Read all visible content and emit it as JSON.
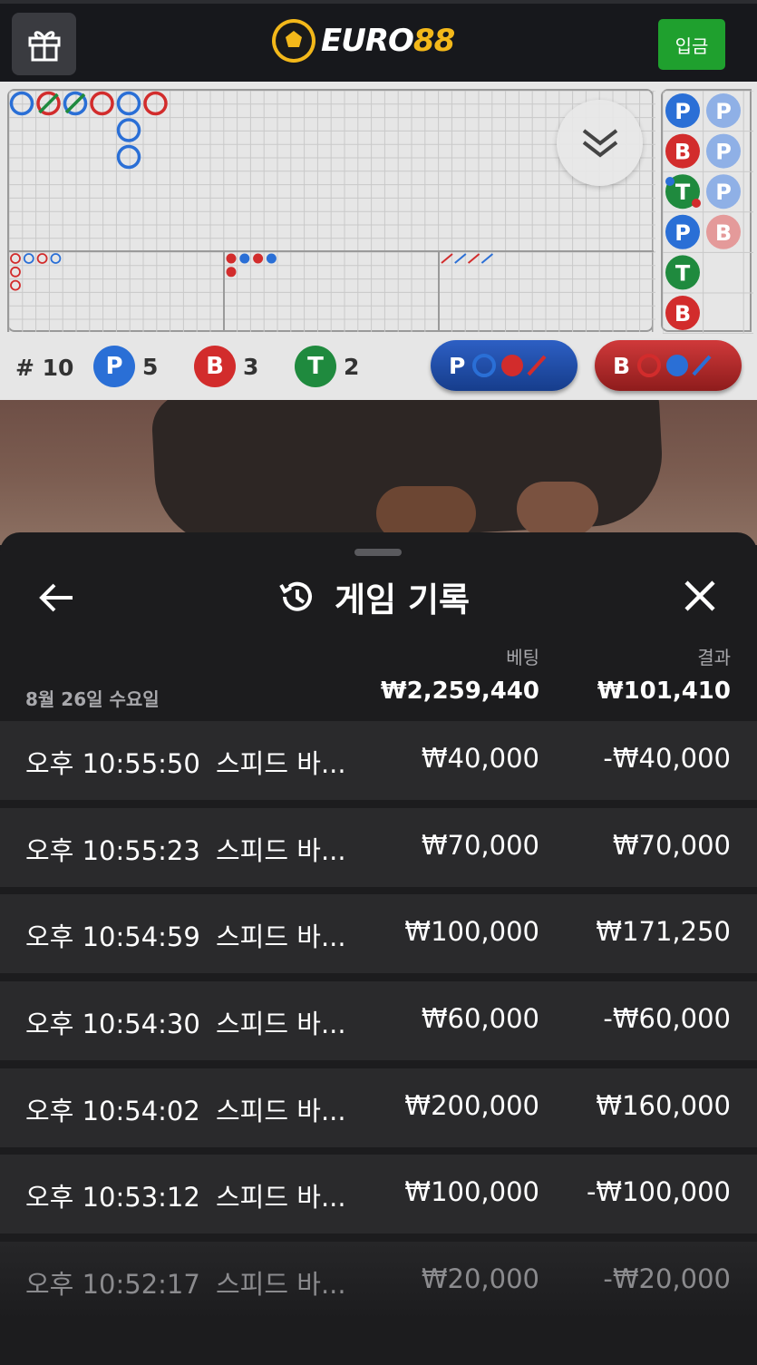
{
  "header": {
    "logo_text_main": "EURO",
    "logo_text_num": "88",
    "deposit_label": "입금",
    "gift_icon": "gift-icon"
  },
  "roadmap": {
    "total_label": "# 10",
    "player": {
      "label": "P",
      "count": "5"
    },
    "banker": {
      "label": "B",
      "count": "3"
    },
    "tie": {
      "label": "T",
      "count": "2"
    },
    "predict_player_label": "P",
    "predict_banker_label": "B",
    "side_column_a": [
      "P",
      "B",
      "T",
      "P",
      "T",
      "B"
    ],
    "side_column_b": [
      "P",
      "P",
      "P",
      "B"
    ],
    "colors": {
      "player": "#2a6fd6",
      "banker": "#d22c2c",
      "tie": "#1f8a3e"
    }
  },
  "sheet": {
    "title": "게임 기록",
    "bet_header": "베팅",
    "result_header": "결과",
    "date_label": "8월 26일 수요일",
    "total_bet": "₩2,259,440",
    "total_result": "₩101,410",
    "rows": [
      {
        "time": "오후 10:55:50",
        "game": "스피드 바...",
        "bet": "₩40,000",
        "result": "-₩40,000"
      },
      {
        "time": "오후 10:55:23",
        "game": "스피드 바...",
        "bet": "₩70,000",
        "result": "₩70,000"
      },
      {
        "time": "오후 10:54:59",
        "game": "스피드 바...",
        "bet": "₩100,000",
        "result": "₩171,250"
      },
      {
        "time": "오후 10:54:30",
        "game": "스피드 바...",
        "bet": "₩60,000",
        "result": "-₩60,000"
      },
      {
        "time": "오후 10:54:02",
        "game": "스피드 바...",
        "bet": "₩200,000",
        "result": "₩160,000"
      },
      {
        "time": "오후 10:53:12",
        "game": "스피드 바...",
        "bet": "₩100,000",
        "result": "-₩100,000"
      },
      {
        "time": "오후 10:52:17",
        "game": "스피드 바...",
        "bet": "₩20,000",
        "result": "-₩20,000"
      }
    ]
  }
}
